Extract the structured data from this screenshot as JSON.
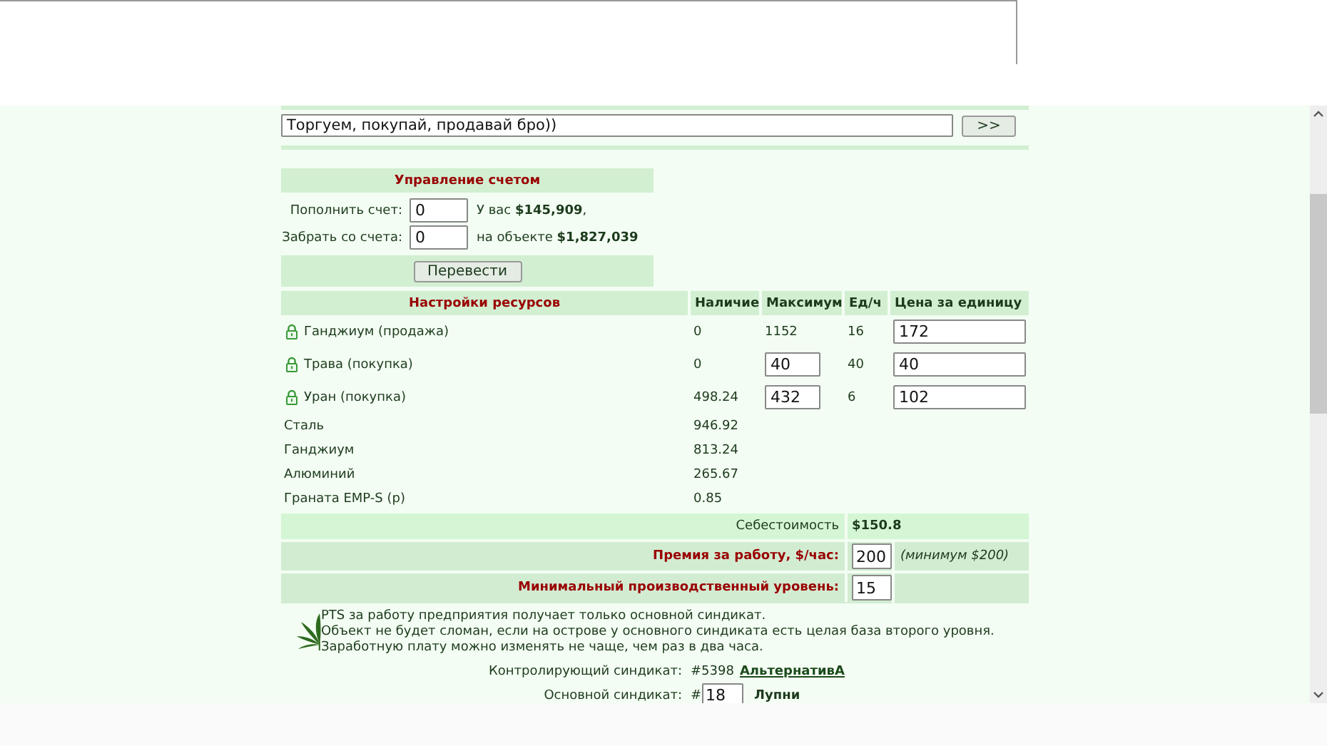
{
  "message_bar": {
    "value": "Торгуем, покупай, продавай бро))",
    "button": ">>"
  },
  "account": {
    "title": "Управление счетом",
    "rows": [
      {
        "label": "Пополнить счет:",
        "value": "0",
        "info": "У вас **$145,909**,"
      },
      {
        "label": "Забрать со счета:",
        "value": "0",
        "info": "на объекте **$1,827,039**"
      }
    ],
    "button": "Перевести"
  },
  "resources": {
    "columns": [
      "Настройки ресурсов",
      "Наличие",
      "Максимум",
      "Ед/ч",
      "Цена за единицу"
    ],
    "rows": [
      {
        "kind": "trade",
        "name": "Ганджиум (продажа)",
        "stock": "0",
        "max": {
          "value": "1152",
          "editable": false
        },
        "rate": "16",
        "price": "172"
      },
      {
        "kind": "trade",
        "name": "Трава (покупка)",
        "stock": "0",
        "max": {
          "value": "40",
          "editable": true
        },
        "rate": "40",
        "price": "40"
      },
      {
        "kind": "trade",
        "name": "Уран (покупка)",
        "stock": "498.24",
        "max": {
          "value": "432",
          "editable": true
        },
        "rate": "6",
        "price": "102"
      },
      {
        "kind": "stock",
        "name": "Сталь",
        "stock": "946.92"
      },
      {
        "kind": "stock",
        "name": "Ганджиум",
        "stock": "813.24"
      },
      {
        "kind": "stock",
        "name": "Алюминий",
        "stock": "265.67"
      },
      {
        "kind": "stock",
        "name": "Граната EMP-S (р)",
        "stock": "0.85"
      }
    ]
  },
  "summary": [
    {
      "kind": "text",
      "label": "Себестоимость",
      "value": "$150.8"
    },
    {
      "kind": "input",
      "label": "Премия за работу, $/час:",
      "value": "200",
      "note": "(минимум $200)"
    },
    {
      "kind": "input",
      "label": "Минимальный производственный уровень:",
      "value": "15"
    }
  ],
  "notes": [
    "PTS за работу предприятия получает только основной синдикат.",
    "Объект не будет сломан, если на острове у основного синдиката есть целая база второго уровня.",
    "Заработную плату можно изменять не чаще, чем раз в два часа."
  ],
  "syndicates": [
    {
      "kind": "link",
      "label": "Контролирующий синдикат:",
      "number": "#5398",
      "name": "АльтернативА"
    },
    {
      "kind": "input",
      "label": "Основной синдикат:",
      "prefix": "#",
      "number": "18",
      "name": "Лупни"
    }
  ]
}
